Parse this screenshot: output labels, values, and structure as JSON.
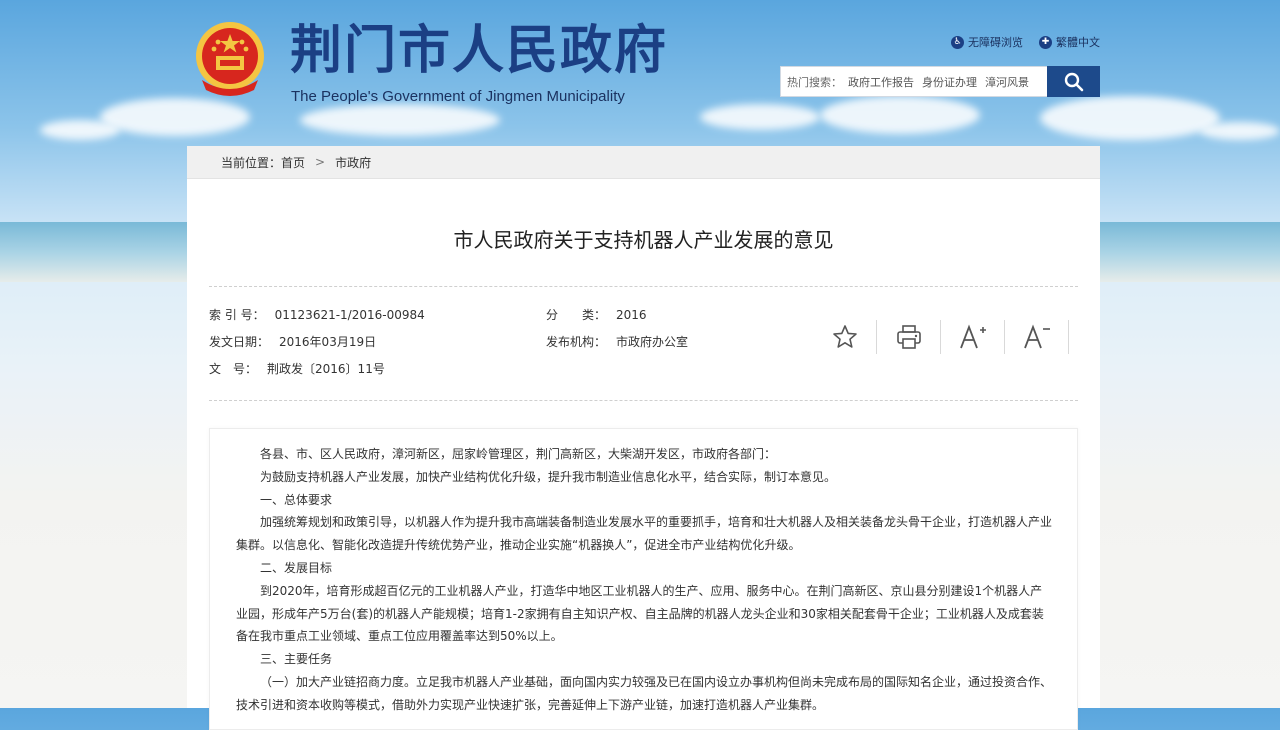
{
  "header": {
    "title_cn": "荆门市人民政府",
    "title_en": "The People's Government of Jingmen Municipality",
    "links": [
      {
        "icon": "accessibility-icon",
        "label": "无障碍浏览"
      },
      {
        "icon": "traditional-chinese-icon",
        "label": "繁體中文"
      }
    ],
    "search": {
      "label": "热门搜索：",
      "hot_terms": [
        "政府工作报告",
        "身份证办理",
        "漳河风景"
      ]
    }
  },
  "breadcrumb": {
    "label": "当前位置：",
    "items": [
      "首页",
      "市政府"
    ]
  },
  "article": {
    "title": "市人民政府关于支持机器人产业发展的意见",
    "meta": {
      "index_label": "索 引 号：",
      "index_value": "01123621-1/2016-00984",
      "category_label": "分　　类：",
      "category_value": "2016",
      "date_label": "发文日期：",
      "date_value": "2016年03月19日",
      "publisher_label": "发布机构：",
      "publisher_value": "市政府办公室",
      "docno_label": "文　号：",
      "docno_value": "荆政发〔2016〕11号"
    },
    "tools": [
      "star-icon",
      "print-icon",
      "font-increase-icon",
      "font-decrease-icon"
    ],
    "paragraphs": [
      "各县、市、区人民政府，漳河新区，屈家岭管理区，荆门高新区，大柴湖开发区，市政府各部门：",
      "为鼓励支持机器人产业发展，加快产业结构优化升级，提升我市制造业信息化水平，结合实际，制订本意见。",
      "一、总体要求",
      "加强统筹规划和政策引导，以机器人作为提升我市高端装备制造业发展水平的重要抓手，培育和壮大机器人及相关装备龙头骨干企业，打造机器人产业集群。以信息化、智能化改造提升传统优势产业，推动企业实施“机器换人”，促进全市产业结构优化升级。",
      "二、发展目标",
      "到2020年，培育形成超百亿元的工业机器人产业，打造华中地区工业机器人的生产、应用、服务中心。在荆门高新区、京山县分别建设1个机器人产业园，形成年产5万台(套)的机器人产能规模；培育1-2家拥有自主知识产权、自主品牌的机器人龙头企业和30家相关配套骨干企业；工业机器人及成套装备在我市重点工业领域、重点工位应用覆盖率达到50%以上。",
      "三、主要任务",
      "（一）加大产业链招商力度。立足我市机器人产业基础，面向国内实力较强及已在国内设立办事机构但尚未完成布局的国际知名企业，通过投资合作、技术引进和资本收购等模式，借助外力实现产业快速扩张，完善延伸上下游产业链，加速打造机器人产业集群。"
    ]
  }
}
